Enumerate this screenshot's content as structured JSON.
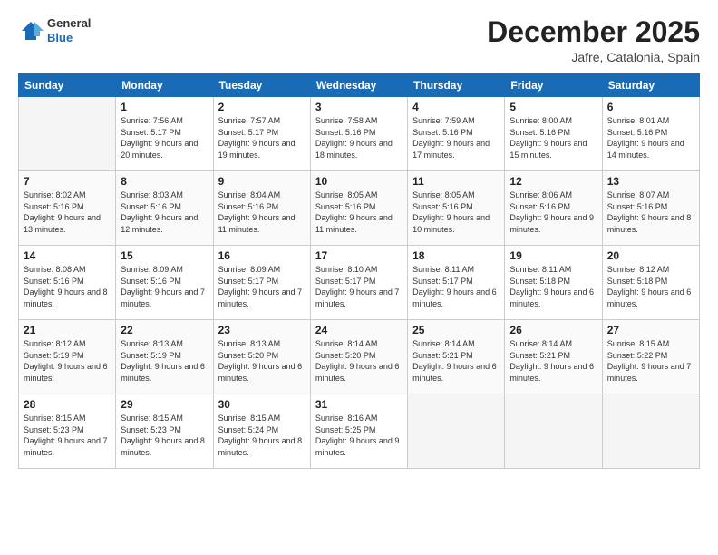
{
  "logo": {
    "general": "General",
    "blue": "Blue"
  },
  "header": {
    "month": "December 2025",
    "location": "Jafre, Catalonia, Spain"
  },
  "weekdays": [
    "Sunday",
    "Monday",
    "Tuesday",
    "Wednesday",
    "Thursday",
    "Friday",
    "Saturday"
  ],
  "weeks": [
    [
      {
        "day": "",
        "sunrise": "",
        "sunset": "",
        "daylight": ""
      },
      {
        "day": "1",
        "sunrise": "Sunrise: 7:56 AM",
        "sunset": "Sunset: 5:17 PM",
        "daylight": "Daylight: 9 hours and 20 minutes."
      },
      {
        "day": "2",
        "sunrise": "Sunrise: 7:57 AM",
        "sunset": "Sunset: 5:17 PM",
        "daylight": "Daylight: 9 hours and 19 minutes."
      },
      {
        "day": "3",
        "sunrise": "Sunrise: 7:58 AM",
        "sunset": "Sunset: 5:16 PM",
        "daylight": "Daylight: 9 hours and 18 minutes."
      },
      {
        "day": "4",
        "sunrise": "Sunrise: 7:59 AM",
        "sunset": "Sunset: 5:16 PM",
        "daylight": "Daylight: 9 hours and 17 minutes."
      },
      {
        "day": "5",
        "sunrise": "Sunrise: 8:00 AM",
        "sunset": "Sunset: 5:16 PM",
        "daylight": "Daylight: 9 hours and 15 minutes."
      },
      {
        "day": "6",
        "sunrise": "Sunrise: 8:01 AM",
        "sunset": "Sunset: 5:16 PM",
        "daylight": "Daylight: 9 hours and 14 minutes."
      }
    ],
    [
      {
        "day": "7",
        "sunrise": "Sunrise: 8:02 AM",
        "sunset": "Sunset: 5:16 PM",
        "daylight": "Daylight: 9 hours and 13 minutes."
      },
      {
        "day": "8",
        "sunrise": "Sunrise: 8:03 AM",
        "sunset": "Sunset: 5:16 PM",
        "daylight": "Daylight: 9 hours and 12 minutes."
      },
      {
        "day": "9",
        "sunrise": "Sunrise: 8:04 AM",
        "sunset": "Sunset: 5:16 PM",
        "daylight": "Daylight: 9 hours and 11 minutes."
      },
      {
        "day": "10",
        "sunrise": "Sunrise: 8:05 AM",
        "sunset": "Sunset: 5:16 PM",
        "daylight": "Daylight: 9 hours and 11 minutes."
      },
      {
        "day": "11",
        "sunrise": "Sunrise: 8:05 AM",
        "sunset": "Sunset: 5:16 PM",
        "daylight": "Daylight: 9 hours and 10 minutes."
      },
      {
        "day": "12",
        "sunrise": "Sunrise: 8:06 AM",
        "sunset": "Sunset: 5:16 PM",
        "daylight": "Daylight: 9 hours and 9 minutes."
      },
      {
        "day": "13",
        "sunrise": "Sunrise: 8:07 AM",
        "sunset": "Sunset: 5:16 PM",
        "daylight": "Daylight: 9 hours and 8 minutes."
      }
    ],
    [
      {
        "day": "14",
        "sunrise": "Sunrise: 8:08 AM",
        "sunset": "Sunset: 5:16 PM",
        "daylight": "Daylight: 9 hours and 8 minutes."
      },
      {
        "day": "15",
        "sunrise": "Sunrise: 8:09 AM",
        "sunset": "Sunset: 5:16 PM",
        "daylight": "Daylight: 9 hours and 7 minutes."
      },
      {
        "day": "16",
        "sunrise": "Sunrise: 8:09 AM",
        "sunset": "Sunset: 5:17 PM",
        "daylight": "Daylight: 9 hours and 7 minutes."
      },
      {
        "day": "17",
        "sunrise": "Sunrise: 8:10 AM",
        "sunset": "Sunset: 5:17 PM",
        "daylight": "Daylight: 9 hours and 7 minutes."
      },
      {
        "day": "18",
        "sunrise": "Sunrise: 8:11 AM",
        "sunset": "Sunset: 5:17 PM",
        "daylight": "Daylight: 9 hours and 6 minutes."
      },
      {
        "day": "19",
        "sunrise": "Sunrise: 8:11 AM",
        "sunset": "Sunset: 5:18 PM",
        "daylight": "Daylight: 9 hours and 6 minutes."
      },
      {
        "day": "20",
        "sunrise": "Sunrise: 8:12 AM",
        "sunset": "Sunset: 5:18 PM",
        "daylight": "Daylight: 9 hours and 6 minutes."
      }
    ],
    [
      {
        "day": "21",
        "sunrise": "Sunrise: 8:12 AM",
        "sunset": "Sunset: 5:19 PM",
        "daylight": "Daylight: 9 hours and 6 minutes."
      },
      {
        "day": "22",
        "sunrise": "Sunrise: 8:13 AM",
        "sunset": "Sunset: 5:19 PM",
        "daylight": "Daylight: 9 hours and 6 minutes."
      },
      {
        "day": "23",
        "sunrise": "Sunrise: 8:13 AM",
        "sunset": "Sunset: 5:20 PM",
        "daylight": "Daylight: 9 hours and 6 minutes."
      },
      {
        "day": "24",
        "sunrise": "Sunrise: 8:14 AM",
        "sunset": "Sunset: 5:20 PM",
        "daylight": "Daylight: 9 hours and 6 minutes."
      },
      {
        "day": "25",
        "sunrise": "Sunrise: 8:14 AM",
        "sunset": "Sunset: 5:21 PM",
        "daylight": "Daylight: 9 hours and 6 minutes."
      },
      {
        "day": "26",
        "sunrise": "Sunrise: 8:14 AM",
        "sunset": "Sunset: 5:21 PM",
        "daylight": "Daylight: 9 hours and 6 minutes."
      },
      {
        "day": "27",
        "sunrise": "Sunrise: 8:15 AM",
        "sunset": "Sunset: 5:22 PM",
        "daylight": "Daylight: 9 hours and 7 minutes."
      }
    ],
    [
      {
        "day": "28",
        "sunrise": "Sunrise: 8:15 AM",
        "sunset": "Sunset: 5:23 PM",
        "daylight": "Daylight: 9 hours and 7 minutes."
      },
      {
        "day": "29",
        "sunrise": "Sunrise: 8:15 AM",
        "sunset": "Sunset: 5:23 PM",
        "daylight": "Daylight: 9 hours and 8 minutes."
      },
      {
        "day": "30",
        "sunrise": "Sunrise: 8:15 AM",
        "sunset": "Sunset: 5:24 PM",
        "daylight": "Daylight: 9 hours and 8 minutes."
      },
      {
        "day": "31",
        "sunrise": "Sunrise: 8:16 AM",
        "sunset": "Sunset: 5:25 PM",
        "daylight": "Daylight: 9 hours and 9 minutes."
      },
      {
        "day": "",
        "sunrise": "",
        "sunset": "",
        "daylight": ""
      },
      {
        "day": "",
        "sunrise": "",
        "sunset": "",
        "daylight": ""
      },
      {
        "day": "",
        "sunrise": "",
        "sunset": "",
        "daylight": ""
      }
    ]
  ]
}
